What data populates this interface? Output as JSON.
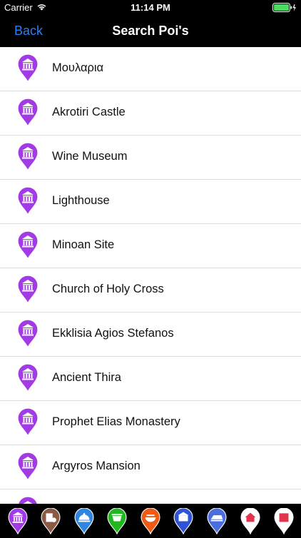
{
  "status_bar": {
    "carrier": "Carrier",
    "time": "11:14 PM"
  },
  "nav_bar": {
    "back_label": "Back",
    "title": "Search Poi's"
  },
  "colors": {
    "accent": "#2f7df6",
    "poi_pin": "#a23ae6",
    "battery": "#4cd964"
  },
  "poi_list": {
    "items": [
      {
        "label": "Μουλαρια",
        "icon": "museum-icon"
      },
      {
        "label": "Akrotiri Castle",
        "icon": "museum-icon"
      },
      {
        "label": "Wine Museum",
        "icon": "museum-icon"
      },
      {
        "label": "Lighthouse",
        "icon": "museum-icon"
      },
      {
        "label": "Minoan Site",
        "icon": "museum-icon"
      },
      {
        "label": "Church of Holy Cross",
        "icon": "museum-icon"
      },
      {
        "label": "Ekklisia Agios Stefanos",
        "icon": "museum-icon"
      },
      {
        "label": "Ancient Thira",
        "icon": "museum-icon"
      },
      {
        "label": "Prophet Elias Monastery",
        "icon": "museum-icon"
      },
      {
        "label": "Argyros Mansion",
        "icon": "museum-icon"
      }
    ]
  },
  "tab_bar": {
    "items": [
      {
        "icon": "museum-icon",
        "color": "#a23ae6"
      },
      {
        "icon": "hotel-icon",
        "color": "#8b5a44"
      },
      {
        "icon": "restaurant-icon",
        "color": "#2f86e0"
      },
      {
        "icon": "cafe-icon",
        "color": "#1fb81f"
      },
      {
        "icon": "food-icon",
        "color": "#f05a14"
      },
      {
        "icon": "shop-icon",
        "color": "#2f52d6"
      },
      {
        "icon": "transport-icon",
        "color": "#4a6ee0"
      },
      {
        "icon": "home-icon",
        "color": "#ffffff"
      },
      {
        "icon": "info-icon",
        "color": "#ffffff"
      }
    ]
  }
}
